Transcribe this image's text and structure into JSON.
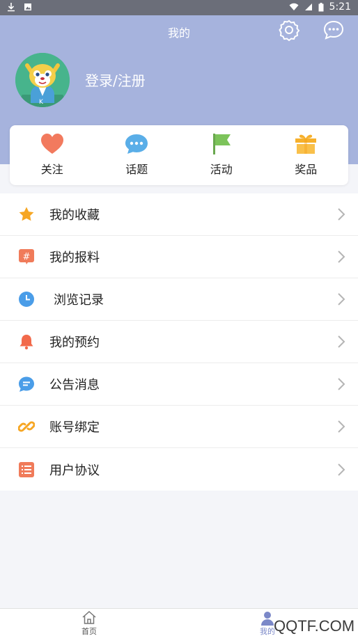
{
  "status_bar": {
    "time": "5:21"
  },
  "header": {
    "title": "我的",
    "login_text": "登录/注册",
    "bg_color": "#a6b3dd"
  },
  "quick_actions": [
    {
      "label": "关注",
      "icon": "heart-icon"
    },
    {
      "label": "话题",
      "icon": "chat-bubble-icon"
    },
    {
      "label": "活动",
      "icon": "flag-icon"
    },
    {
      "label": "奖品",
      "icon": "gift-icon"
    }
  ],
  "menu": [
    {
      "label": "我的收藏",
      "icon": "star-icon"
    },
    {
      "label": "我的报料",
      "icon": "hash-icon"
    },
    {
      "label": "浏览记录",
      "icon": "clock-icon"
    },
    {
      "label": "我的预约",
      "icon": "bell-icon"
    },
    {
      "label": "公告消息",
      "icon": "message-icon"
    },
    {
      "label": "账号绑定",
      "icon": "link-icon"
    },
    {
      "label": "用户协议",
      "icon": "list-icon"
    }
  ],
  "bottom_nav": [
    {
      "label": "首页",
      "icon": "home-icon"
    },
    {
      "label": "我的",
      "icon": "user-icon"
    }
  ],
  "watermark": "QQTF.COM",
  "accent_colors": {
    "heart": "#f27a5e",
    "bubble": "#5aaee8",
    "flag": "#7cc35a",
    "gift": "#f6b02c",
    "nav_active": "#7b88c8"
  }
}
